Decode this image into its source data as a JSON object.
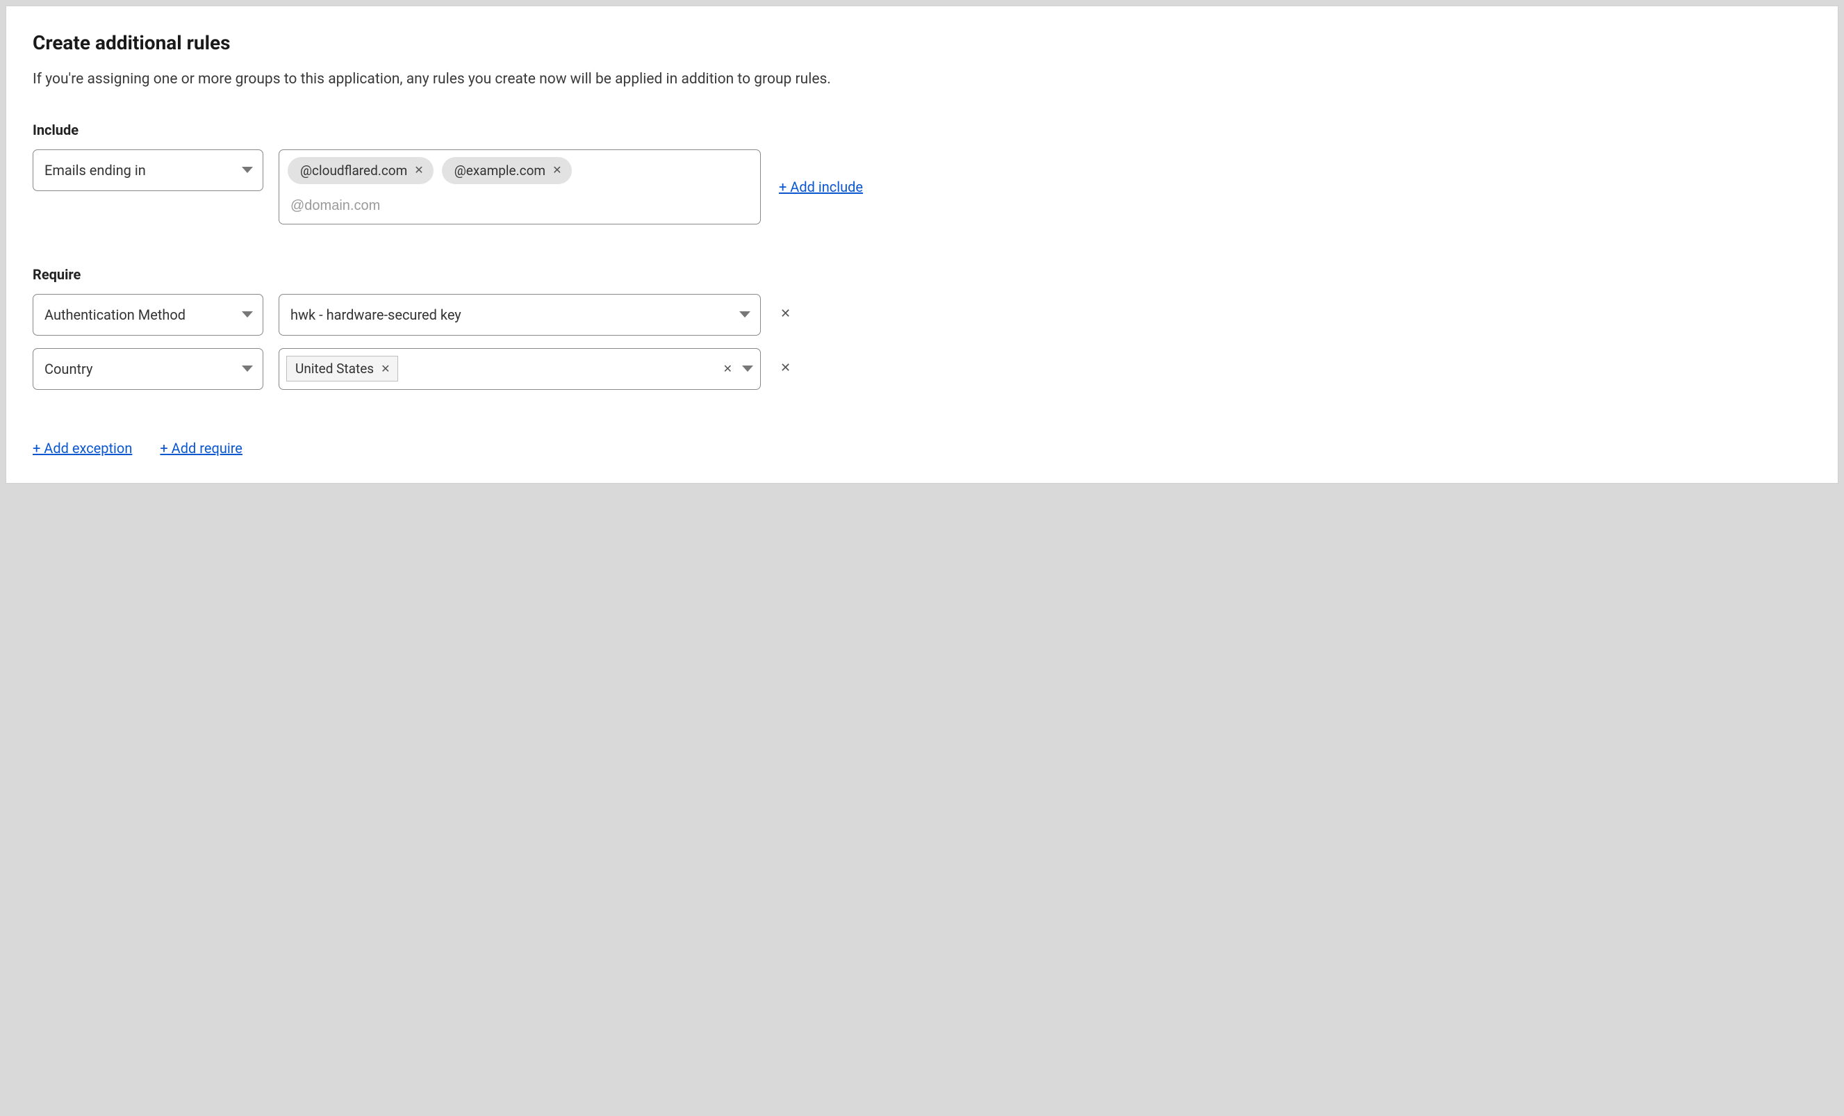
{
  "header": {
    "title": "Create additional rules",
    "description": "If you're assigning one or more groups to this application, any rules you create now will be applied in addition to group rules."
  },
  "include": {
    "label": "Include",
    "selector": "Emails ending in",
    "chips": [
      "@cloudflared.com",
      "@example.com"
    ],
    "placeholder": "@domain.com",
    "add_link": "+ Add include"
  },
  "require": {
    "label": "Require",
    "rows": [
      {
        "selector": "Authentication Method",
        "value": "hwk - hardware-secured key"
      },
      {
        "selector": "Country",
        "chips": [
          "United States"
        ]
      }
    ]
  },
  "footer": {
    "add_exception": "+ Add exception",
    "add_require": "+ Add require"
  }
}
